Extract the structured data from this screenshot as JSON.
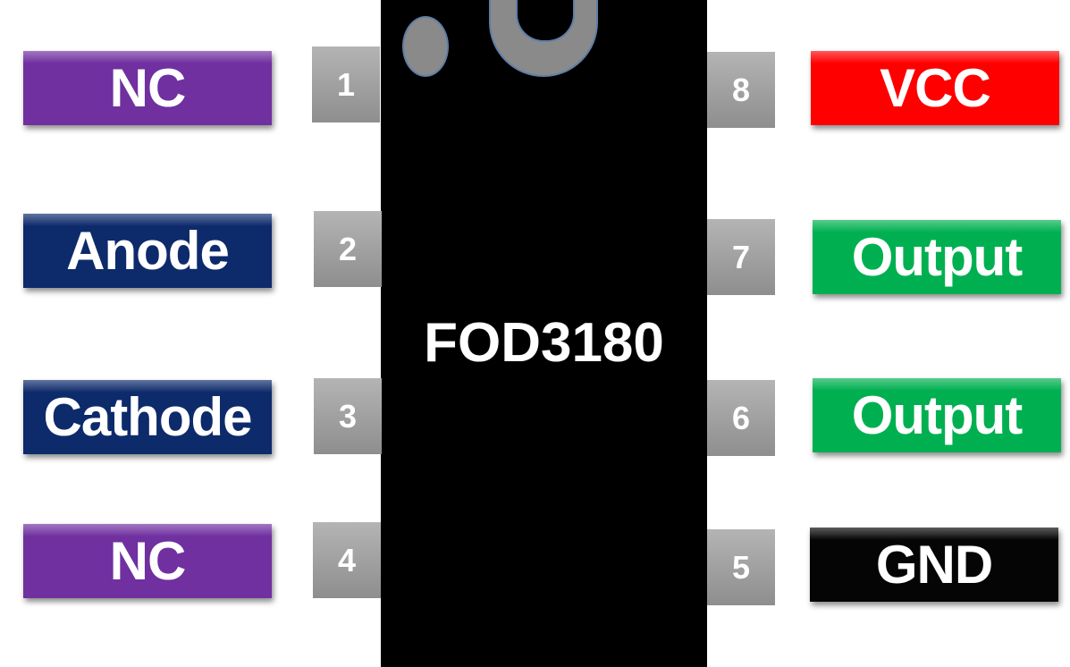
{
  "chip": {
    "part_number": "FOD3180",
    "body_color": "#000000"
  },
  "pins": [
    {
      "number": "1",
      "label": "NC",
      "side": "left",
      "color": "#7030a0"
    },
    {
      "number": "2",
      "label": "Anode",
      "side": "left",
      "color": "#0d2a6b"
    },
    {
      "number": "3",
      "label": "Cathode",
      "side": "left",
      "color": "#0d2a6b"
    },
    {
      "number": "4",
      "label": "NC",
      "side": "left",
      "color": "#7030a0"
    },
    {
      "number": "5",
      "label": "GND",
      "side": "right",
      "color": "#050505"
    },
    {
      "number": "6",
      "label": "Output",
      "side": "right",
      "color": "#00b050"
    },
    {
      "number": "7",
      "label": "Output",
      "side": "right",
      "color": "#00b050"
    },
    {
      "number": "8",
      "label": "VCC",
      "side": "right",
      "color": "#ff0000"
    }
  ],
  "pin_box_color": "#a0a0a0",
  "icons": [
    "pin1-dot-icon",
    "orientation-notch-icon"
  ]
}
